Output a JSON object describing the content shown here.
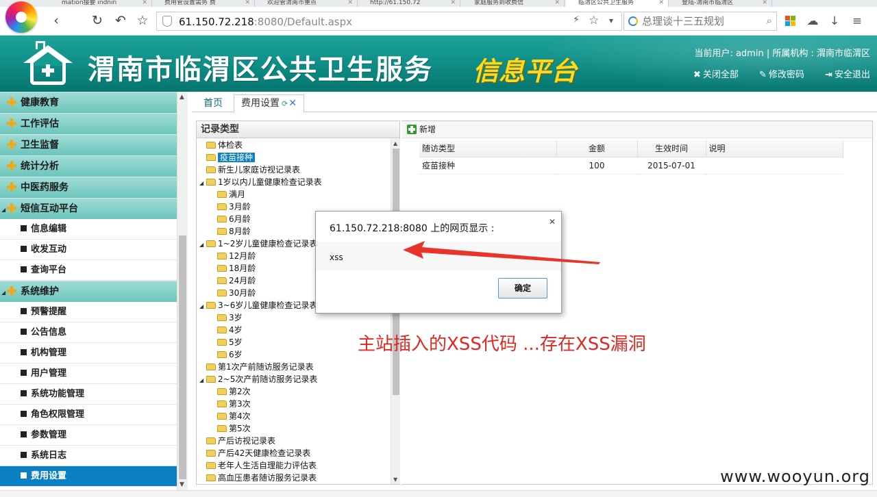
{
  "browser": {
    "tabs": [
      {
        "label": "mation接要 indnin",
        "active": false
      },
      {
        "label": "费用管设置需务 费",
        "active": false
      },
      {
        "label": "欢迎管渭南市重点",
        "active": false
      },
      {
        "label": "http://61.150.72",
        "active": false
      },
      {
        "label": "家庭服务到收费信",
        "active": false
      },
      {
        "label": "临渭区公共卫生服务",
        "active": true
      },
      {
        "label": "登陆-渭南市临渭区",
        "active": false
      }
    ],
    "url_host": "61.150.72.218",
    "url_rest": ":8080/Default.aspx",
    "search_placeholder": "总理谈十三五规划"
  },
  "header": {
    "title": "渭南市临渭区公共卫生服务",
    "subtitle": "信息平台",
    "current_user_label": "当前用户: ",
    "current_user": "admin",
    "org_label": " | 所属机构 : ",
    "org": "渭南市临渭区",
    "actions": [
      "关闭全部",
      "修改密码",
      "安全退出"
    ]
  },
  "sidebar": {
    "groups_top": [
      "健康教育",
      "工作评估",
      "卫生监督",
      "统计分析",
      "中医药服务",
      "短信互动平台"
    ],
    "sms_items": [
      "信息编辑",
      "收发互动",
      "查询平台"
    ],
    "system_group": "系统维护",
    "system_items": [
      "预警提醒",
      "公告信息",
      "机构管理",
      "用户管理",
      "系统功能管理",
      "角色权限管理",
      "参数管理",
      "系统日志",
      "费用设置"
    ],
    "active_item": "费用设置"
  },
  "content_tabs": {
    "home": "首页",
    "fee": "费用设置"
  },
  "tree_panel": {
    "title": "记录类型",
    "rows": [
      {
        "label": "体检表",
        "level": 0,
        "expander": "",
        "selected": false
      },
      {
        "label": "疫苗接种",
        "level": 0,
        "expander": "",
        "selected": true
      },
      {
        "label": "新生儿家庭访视记录表",
        "level": 0,
        "expander": "",
        "selected": false
      },
      {
        "label": "1岁以内儿童健康检查记录表",
        "level": 0,
        "expander": "◢",
        "selected": false
      },
      {
        "label": "满月",
        "level": 1,
        "expander": "",
        "selected": false
      },
      {
        "label": "3月龄",
        "level": 1,
        "expander": "",
        "selected": false
      },
      {
        "label": "6月龄",
        "level": 1,
        "expander": "",
        "selected": false
      },
      {
        "label": "8月龄",
        "level": 1,
        "expander": "",
        "selected": false
      },
      {
        "label": "1~2岁儿童健康检查记录表",
        "level": 0,
        "expander": "◢",
        "selected": false
      },
      {
        "label": "12月龄",
        "level": 1,
        "expander": "",
        "selected": false
      },
      {
        "label": "18月龄",
        "level": 1,
        "expander": "",
        "selected": false
      },
      {
        "label": "24月龄",
        "level": 1,
        "expander": "",
        "selected": false
      },
      {
        "label": "30月龄",
        "level": 1,
        "expander": "",
        "selected": false
      },
      {
        "label": "3~6岁儿童健康检查记录表",
        "level": 0,
        "expander": "◢",
        "selected": false
      },
      {
        "label": "3岁",
        "level": 1,
        "expander": "",
        "selected": false
      },
      {
        "label": "4岁",
        "level": 1,
        "expander": "",
        "selected": false
      },
      {
        "label": "5岁",
        "level": 1,
        "expander": "",
        "selected": false
      },
      {
        "label": "6岁",
        "level": 1,
        "expander": "",
        "selected": false
      },
      {
        "label": "第1次产前随访服务记录表",
        "level": 0,
        "expander": "",
        "selected": false
      },
      {
        "label": "2~5次产前随访服务记录表",
        "level": 0,
        "expander": "◢",
        "selected": false
      },
      {
        "label": "第2次",
        "level": 1,
        "expander": "",
        "selected": false
      },
      {
        "label": "第3次",
        "level": 1,
        "expander": "",
        "selected": false
      },
      {
        "label": "第4次",
        "level": 1,
        "expander": "",
        "selected": false
      },
      {
        "label": "第5次",
        "level": 1,
        "expander": "",
        "selected": false
      },
      {
        "label": "产后访视记录表",
        "level": 0,
        "expander": "",
        "selected": false
      },
      {
        "label": "产后42天健康检查记录表",
        "level": 0,
        "expander": "",
        "selected": false
      },
      {
        "label": "老年人生活自理能力评估表",
        "level": 0,
        "expander": "",
        "selected": false
      },
      {
        "label": "高血压患者随访服务记录表",
        "level": 0,
        "expander": "",
        "selected": false
      }
    ]
  },
  "grid": {
    "add_label": "新增",
    "columns": [
      "随访类型",
      "金额",
      "生效时间",
      "说明"
    ],
    "rows": [
      [
        "疫苗接种",
        "100",
        "2015-07-01",
        ""
      ]
    ]
  },
  "dialog": {
    "title": "61.150.72.218:8080 上的网页显示 :",
    "message": "xss",
    "ok_label": "确定"
  },
  "annotation": "主站插入的XSS代码 ...存在XSS漏洞",
  "watermark": "www.wooyun.org",
  "colors": {
    "header_teal": "#0d8c84",
    "subtitle_yellow": "#ffd91a",
    "selected_blue": "#0a7fc2",
    "annotation_red": "#e0281f"
  }
}
